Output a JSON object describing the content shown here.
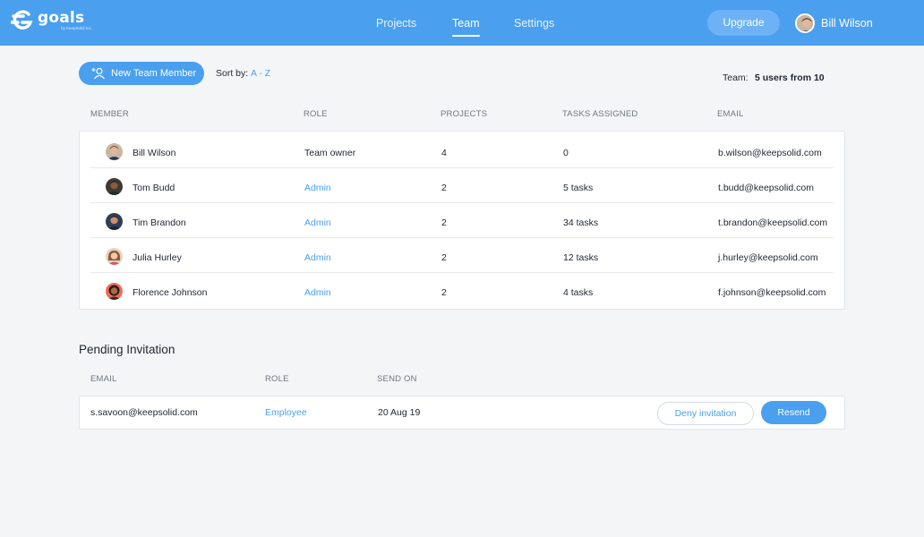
{
  "brand": {
    "name": "goals",
    "byline": "by KeepSolid Inc."
  },
  "nav": {
    "tabs": [
      {
        "label": "Projects",
        "active": false
      },
      {
        "label": "Team",
        "active": true
      },
      {
        "label": "Settings",
        "active": false
      }
    ],
    "upgrade_label": "Upgrade",
    "user_name": "Bill Wilson"
  },
  "toolbar": {
    "new_member_label": "New Team Member",
    "sort_label": "Sort by:",
    "sort_value": "A - Z",
    "team_label": "Team:",
    "team_value": "5 users from 10"
  },
  "members": {
    "columns": [
      "MEMBER",
      "ROLE",
      "PROJECTS",
      "TASKS ASSIGNED",
      "EMAIL"
    ],
    "rows": [
      {
        "name": "Bill Wilson",
        "role": "Team owner",
        "projects": "4",
        "tasks": "0",
        "email": "b.wilson@keepsolid.com"
      },
      {
        "name": "Tom Budd",
        "role": "Admin",
        "projects": "2",
        "tasks": "5 tasks",
        "email": "t.budd@keepsolid.com"
      },
      {
        "name": "Tim Brandon",
        "role": "Admin",
        "projects": "2",
        "tasks": "34 tasks",
        "email": "t.brandon@keepsolid.com"
      },
      {
        "name": "Julia Hurley",
        "role": "Admin",
        "projects": "2",
        "tasks": "12 tasks",
        "email": "j.hurley@keepsolid.com"
      },
      {
        "name": "Florence Johnson",
        "role": "Admin",
        "projects": "2",
        "tasks": "4 tasks",
        "email": "f.johnson@keepsolid.com"
      }
    ]
  },
  "pending": {
    "title": "Pending Invitation",
    "columns": [
      "EMAIL",
      "ROLE",
      "SEND ON"
    ],
    "rows": [
      {
        "email": "s.savoon@keepsolid.com",
        "role": "Employee",
        "sent_on": "20 Aug 19",
        "deny_label": "Deny invitation",
        "resend_label": "Resend"
      }
    ]
  },
  "colors": {
    "accent": "#4a9fef",
    "header_bg": "#4a9fef",
    "page_bg": "#f4f5f7"
  }
}
